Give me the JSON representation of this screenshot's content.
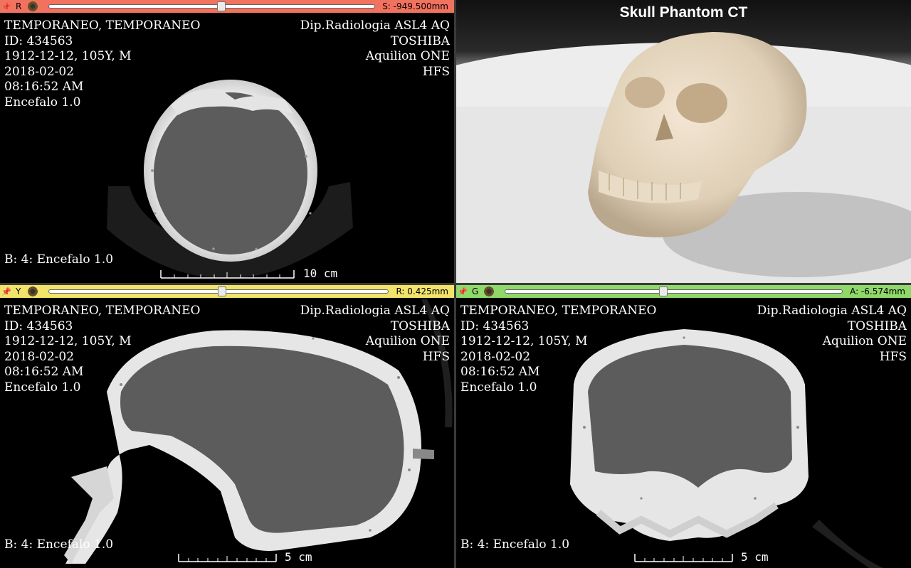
{
  "views": {
    "red": {
      "label": "R",
      "offset": "S: -949.500mm",
      "slider_fraction": 0.53,
      "color": "#f0725f",
      "bottom_left": "B: 4: Encefalo 1.0",
      "scale": "10 cm"
    },
    "yellow": {
      "label": "Y",
      "offset": "R: 0.425mm",
      "slider_fraction": 0.51,
      "color": "#f2e36a",
      "bottom_left": "B: 4: Encefalo 1.0",
      "scale": "5 cm"
    },
    "green": {
      "label": "G",
      "offset": "A: -6.574mm",
      "slider_fraction": 0.47,
      "color": "#8fd96b",
      "bottom_left": "B: 4: Encefalo 1.0",
      "scale": "5 cm"
    },
    "threed": {
      "title": "Skull Phantom CT"
    }
  },
  "patient": {
    "name": "TEMPORANEO, TEMPORANEO",
    "id": "ID: 434563",
    "dob": "1912-12-12, 105Y, M",
    "date": "2018-02-02",
    "time": "08:16:52 AM",
    "series": "Encefalo 1.0",
    "institution": "Dip.Radiologia ASL4 AQ",
    "manufacturer": "TOSHIBA",
    "model": "Aquilion ONE",
    "position": "HFS"
  },
  "icons": {
    "pin": "pin-icon",
    "gear": "gear-icon"
  }
}
